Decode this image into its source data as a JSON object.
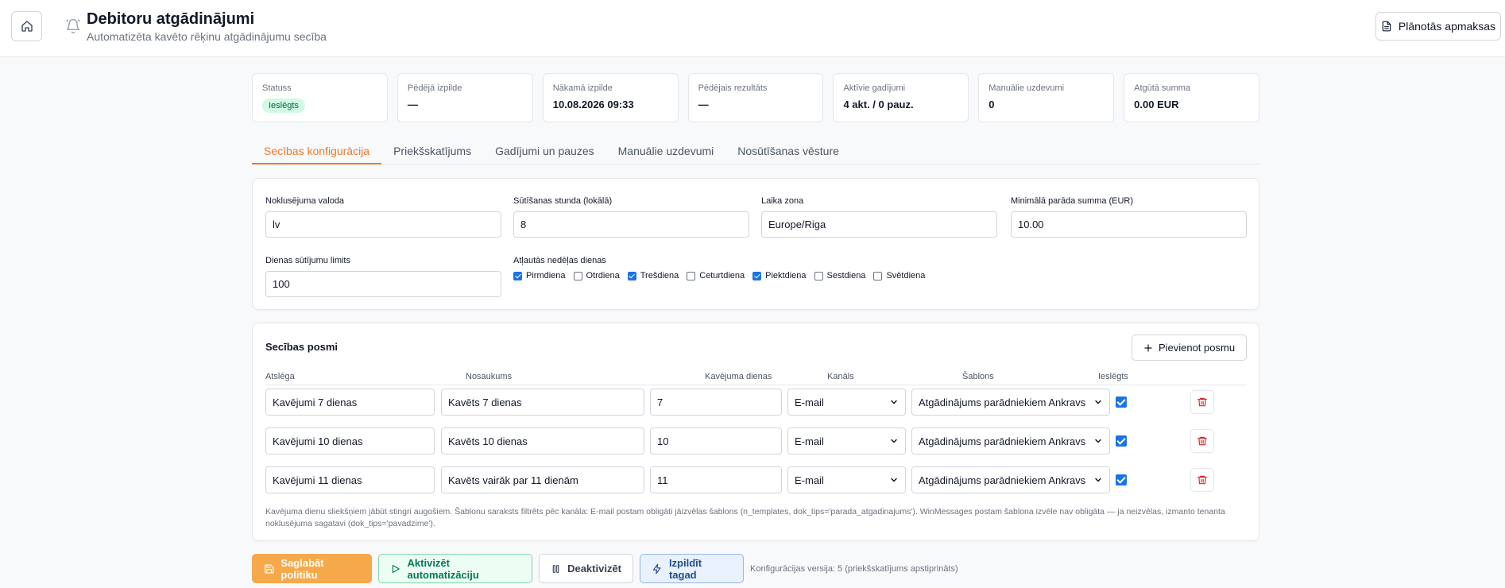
{
  "header": {
    "title": "Debitoru atgādinājumi",
    "subtitle": "Automatizēta kavēto rēķinu atgādinājumu secība",
    "planned_payments": "Plānotās apmaksas"
  },
  "summary": [
    {
      "label": "Statuss",
      "value": "Ieslēgts"
    },
    {
      "label": "Pēdējā izpilde",
      "value": "—"
    },
    {
      "label": "Nākamā izpilde",
      "value": "10.08.2026 09:33"
    },
    {
      "label": "Pēdējais rezultāts",
      "value": "—"
    },
    {
      "label": "Aktīvie gadījumi",
      "value": "4 akt. / 0 pauz."
    },
    {
      "label": "Manuālie uzdevumi",
      "value": "0"
    },
    {
      "label": "Atgūtā summa",
      "value": "0.00 EUR"
    }
  ],
  "tabs": [
    {
      "label": "Secības konfigurācija",
      "active": true
    },
    {
      "label": "Priekšskatījums",
      "active": false
    },
    {
      "label": "Gadījumi un pauzes",
      "active": false
    },
    {
      "label": "Manuālie uzdevumi",
      "active": false
    },
    {
      "label": "Nosūtīšanas vēsture",
      "active": false
    }
  ],
  "config": {
    "default_language": {
      "label": "Noklusējuma valoda",
      "value": "lv"
    },
    "send_hour": {
      "label": "Sūtīšanas stunda (lokālā)",
      "value": "8"
    },
    "timezone": {
      "label": "Laika zona",
      "value": "Europe/Riga"
    },
    "min_debt": {
      "label": "Minimālā parāda summa (EUR)",
      "value": "10.00"
    },
    "daily_limit": {
      "label": "Dienas sūtījumu limits",
      "value": "100"
    },
    "weekdays": {
      "label": "Atļautās nedēļas dienas",
      "days": [
        {
          "name": "Pirmdiena",
          "checked": true
        },
        {
          "name": "Otrdiena",
          "checked": false
        },
        {
          "name": "Trešdiena",
          "checked": true
        },
        {
          "name": "Ceturtdiena",
          "checked": false
        },
        {
          "name": "Piektdiena",
          "checked": true
        },
        {
          "name": "Sestdiena",
          "checked": false
        },
        {
          "name": "Svētdiena",
          "checked": false
        }
      ]
    }
  },
  "steps": {
    "title": "Secības posmi",
    "add_label": "Pievienot posmu",
    "columns": [
      "Atslēga",
      "Nosaukums",
      "Kavējuma dienas",
      "Kanāls",
      "Šablons",
      "Ieslēgts"
    ],
    "rows": [
      {
        "key": "Kavējumi 7 dienas",
        "name": "Kavēts 7 dienas",
        "days": "7",
        "channel": "E-mail",
        "template": "Atgādinājums parādniekiem Ankravs",
        "enabled": true
      },
      {
        "key": "Kavējumi 10 dienas",
        "name": "Kavēts 10 dienas",
        "days": "10",
        "channel": "E-mail",
        "template": "Atgādinājums parādniekiem Ankravs",
        "enabled": true
      },
      {
        "key": "Kavējumi 11 dienas",
        "name": "Kavēts vairāk par 11 dienām",
        "days": "11",
        "channel": "E-mail",
        "template": "Atgādinājums parādniekiem Ankravs",
        "enabled": true
      }
    ],
    "note": "Kavējuma dienu sliekšņiem jābūt stingri augošiem. Šablonu saraksts filtrēts pēc kanāla: E-mail postam obligāti jāizvēlas šablons (n_templates, dok_tips='parada_atgadinajums'). WinMessages postam šablona izvēle nav obligāta — ja neizvēlas, izmanto tenanta noklusējuma sagatavi (dok_tips='pavadzime')."
  },
  "actions": {
    "save": "Saglabāt politiku",
    "activate": "Aktivizēt automatizāciju",
    "deactivate": "Deaktivizēt",
    "run_now": "Izpildīt tagad",
    "config_version": "Konfigurācijas versija: 5 (priekšskatījums apstiprināts)"
  },
  "colors": {
    "accent": "#ea7a2c",
    "checkbox": "#1a73e8",
    "danger": "#dc2626"
  }
}
